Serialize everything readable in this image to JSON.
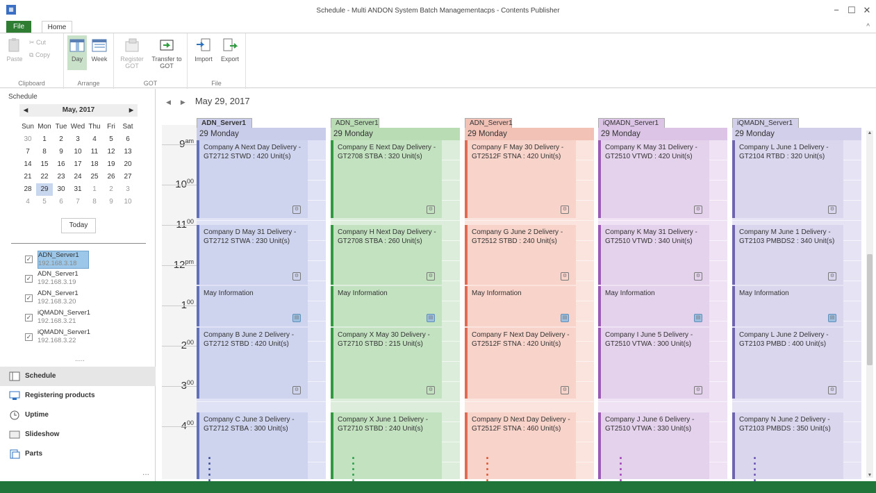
{
  "window": {
    "title": "Schedule - Multi ANDON System Batch Managementacps - Contents Publisher",
    "minimize": "−",
    "maximize": "☐",
    "close": "✕"
  },
  "ribbon_tabs": {
    "file": "File",
    "home": "Home",
    "collapse": "^"
  },
  "ribbon": {
    "clipboard": {
      "paste": "Paste",
      "cut": "Cut",
      "copy": "Copy",
      "label": "Clipboard"
    },
    "arrange": {
      "day": "Day",
      "week": "Week",
      "label": "Arrange"
    },
    "got": {
      "register": "Register GOT",
      "transfer": "Transfer to GOT",
      "label": "GOT"
    },
    "file": {
      "import": "Import",
      "export": "Export",
      "label": "File"
    }
  },
  "sidebar": {
    "heading": "Schedule",
    "calendar": {
      "month": "May, 2017",
      "weekdays": [
        "Sun",
        "Mon",
        "Tue",
        "Wed",
        "Thu",
        "Fri",
        "Sat"
      ],
      "days": [
        "30",
        "1",
        "2",
        "3",
        "4",
        "5",
        "6",
        "7",
        "8",
        "9",
        "10",
        "11",
        "12",
        "13",
        "14",
        "15",
        "16",
        "17",
        "18",
        "19",
        "20",
        "21",
        "22",
        "23",
        "24",
        "25",
        "26",
        "27",
        "28",
        "29",
        "30",
        "31",
        "1",
        "2",
        "3",
        "4",
        "5",
        "6",
        "7",
        "8",
        "9",
        "10"
      ]
    },
    "today_button": "Today",
    "servers": [
      {
        "name": "ADN_Server1",
        "ip": "192.168.3.18",
        "checked": true,
        "selected": true
      },
      {
        "name": "ADN_Server1",
        "ip": "192.168.3.19",
        "checked": true
      },
      {
        "name": "ADN_Server1",
        "ip": "192.168.3.20",
        "checked": true
      },
      {
        "name": "iQMADN_Server1",
        "ip": "192.168.3.21",
        "checked": true
      },
      {
        "name": "iQMADN_Server1",
        "ip": "192.168.3.22",
        "checked": true
      }
    ],
    "more": ".....",
    "nav": [
      "Schedule",
      "Registering products",
      "Uptime",
      "Slideshow",
      "Parts"
    ],
    "nav_more": "..."
  },
  "main": {
    "date": "May 29, 2017",
    "times": [
      {
        "h": "9",
        "s": "am"
      },
      {
        "h": "10",
        "s": "00"
      },
      {
        "h": "11",
        "s": "00"
      },
      {
        "h": "12",
        "s": "pm"
      },
      {
        "h": "1",
        "s": "00"
      },
      {
        "h": "2",
        "s": "00"
      },
      {
        "h": "3",
        "s": "00"
      },
      {
        "h": "4",
        "s": "00"
      }
    ],
    "columns": [
      {
        "server": "ADN_Server1",
        "day": "29  Monday",
        "bold": true,
        "tab_color": "#c9cdea",
        "bg": "#dfe2f4",
        "appt_bg": "#cfd4ee",
        "bar": "#6271b8",
        "dots": "#3b4a9a",
        "appts": [
          {
            "text": "Company A Next Day Delivery - GT2712 STWD : 420 Unit(s)"
          },
          {
            "text": "Company D May 31 Delivery - GT2712 STWA : 230 Unit(s)"
          },
          {
            "text": "May Information"
          },
          {
            "text": "Company B June 2 Delivery - GT2712 STBD : 420 Unit(s)"
          },
          {
            "text": "Company C June 3 Delivery - GT2712 STBA : 300 Unit(s)"
          }
        ]
      },
      {
        "server": "ADN_Server1",
        "day": "29  Monday",
        "tab_color": "#b9dcb5",
        "bg": "#dceedb",
        "appt_bg": "#c2e2c0",
        "bar": "#2f9a3e",
        "dots": "#2c9a48",
        "appts": [
          {
            "text": "Company E Next Day Delivery - GT2708 STBA : 320 Unit(s)"
          },
          {
            "text": "Company H Next Day Delivery - GT2708 STBA : 260 Unit(s)"
          },
          {
            "text": "May Information"
          },
          {
            "text": "Company X May 30 Delivery - GT2710 STBD : 215 Unit(s)"
          },
          {
            "text": "Company X June 1 Delivery - GT2710 STBD : 240 Unit(s)"
          }
        ]
      },
      {
        "server": "ADN_Server1",
        "day": "29  Monday",
        "tab_color": "#f3c2b7",
        "bg": "#fbe4de",
        "appt_bg": "#f7d3c9",
        "bar": "#e06a52",
        "dots": "#e0532b",
        "appts": [
          {
            "text": "Company F May 30 Delivery - GT2512F STNA : 420 Unit(s)"
          },
          {
            "text": "Company G June 2 Delivery - GT2512 STBD : 240 Unit(s)"
          },
          {
            "text": "May Information"
          },
          {
            "text": "Company F Next Day Delivery - GT2512F STNA : 420 Unit(s)"
          },
          {
            "text": "Company D Next Day Delivery - GT2512F STNA : 460 Unit(s)"
          }
        ]
      },
      {
        "server": "iQMADN_Server1",
        "day": "29  Monday",
        "tab_color": "#dcc4e6",
        "bg": "#efe2f4",
        "appt_bg": "#e4d1ec",
        "bar": "#9a5ab5",
        "dots": "#9e3fb4",
        "appts": [
          {
            "text": "Company K May 31 Delivery - GT2510 VTWD : 420 Unit(s)"
          },
          {
            "text": "Company K May 31 Delivery - GT2510 VTWD : 340 Unit(s)"
          },
          {
            "text": "May Information"
          },
          {
            "text": "Company I June 5 Delivery - GT2510 VTWA : 300 Unit(s)"
          },
          {
            "text": "Company J June 6 Delivery - GT2510 VTWA : 330 Unit(s)"
          }
        ]
      },
      {
        "server": "iQMADN_Server1",
        "day": "29  Monday",
        "tab_color": "#d2cfea",
        "bg": "#e6e4f4",
        "appt_bg": "#d9d6ee",
        "bar": "#6e64b0",
        "dots": "#6a4fb0",
        "appts": [
          {
            "text": "Company L June 1 Delivery - GT2104 RTBD : 320 Unit(s)"
          },
          {
            "text": "Company M June 1 Delivery - GT2103 PMBDS2 : 340 Unit(s)"
          },
          {
            "text": "May Information"
          },
          {
            "text": "Company L June 2 Delivery - GT2103 PMBD : 400 Unit(s)"
          },
          {
            "text": "Company N June 2 Delivery - GT2103 PMBDS : 350 Unit(s)"
          }
        ]
      }
    ]
  }
}
